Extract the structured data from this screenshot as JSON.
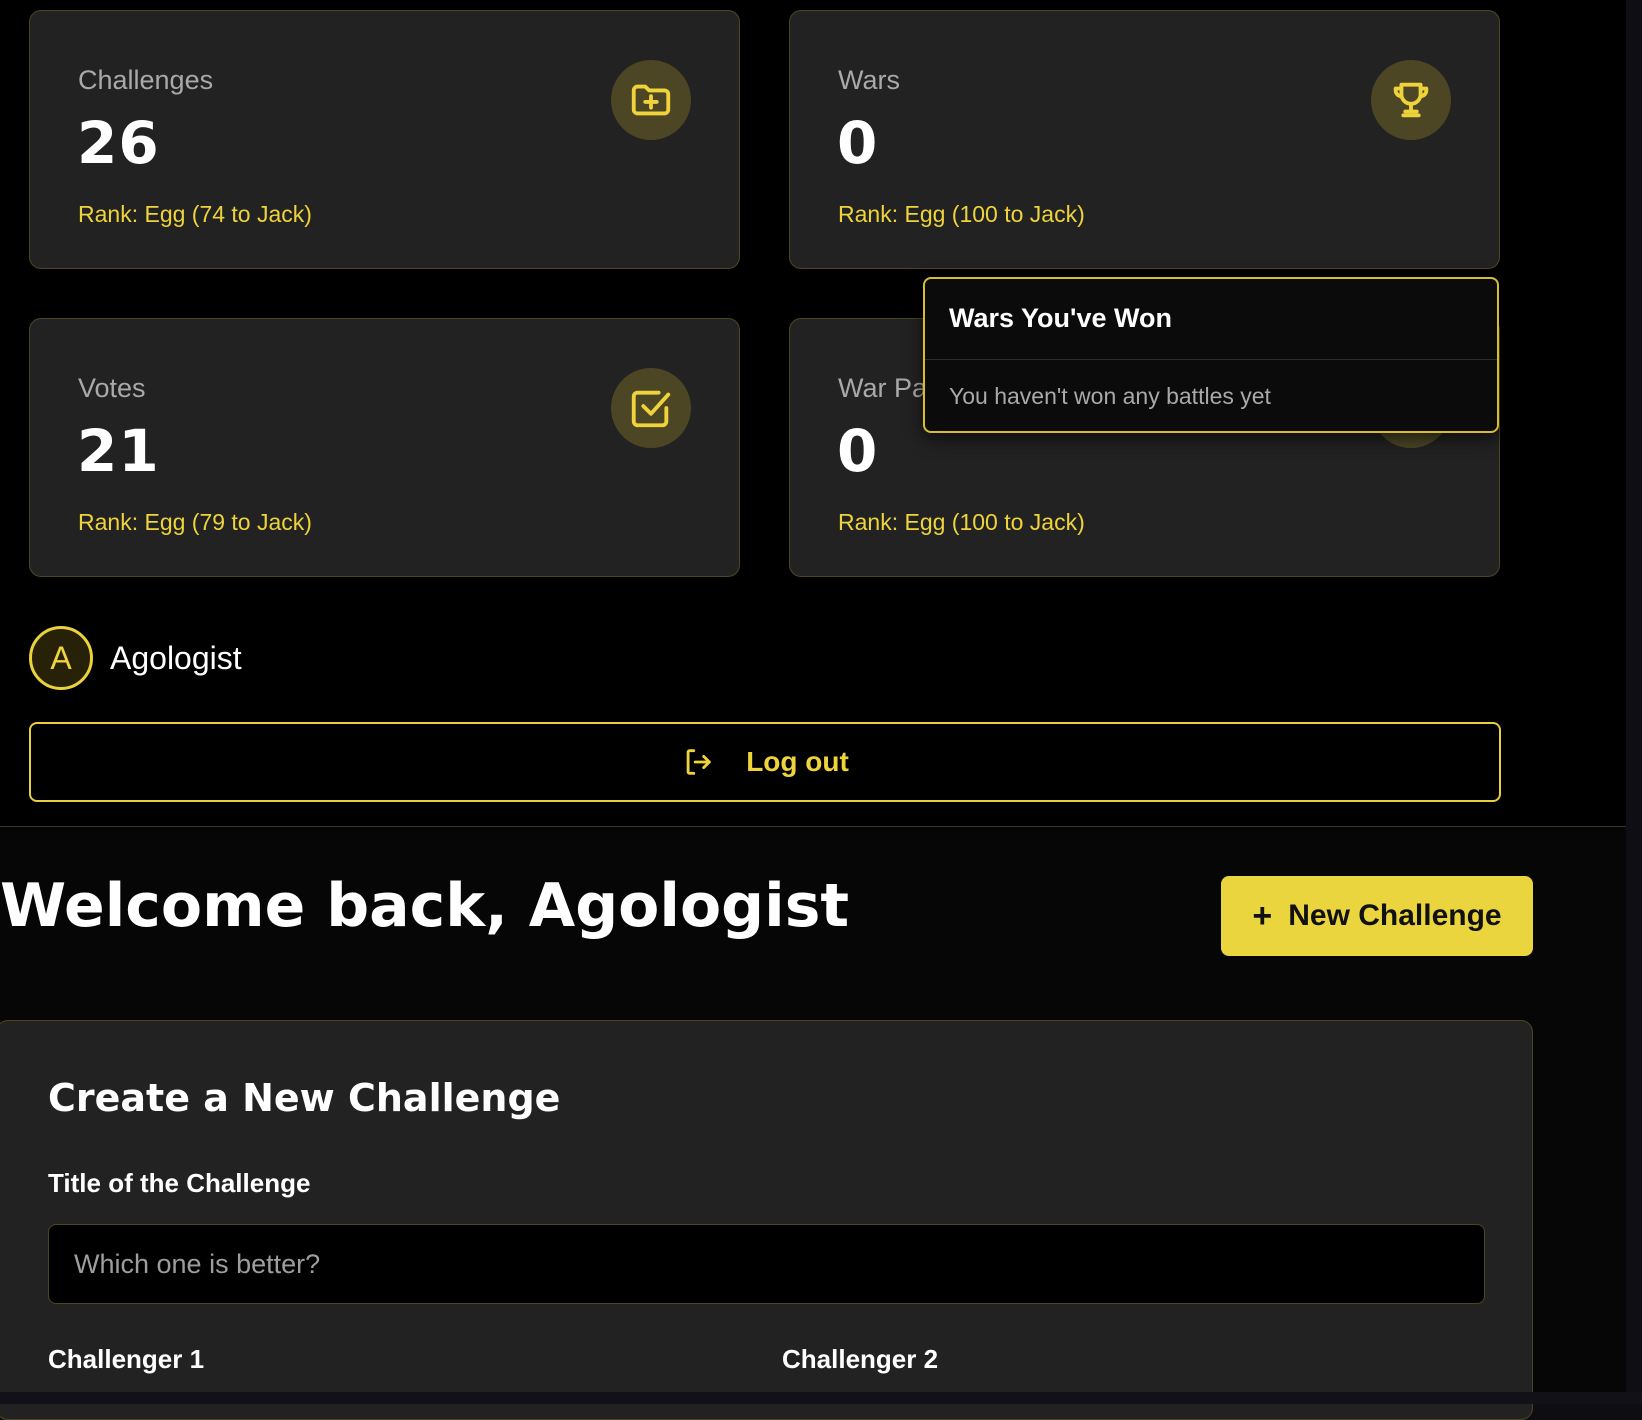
{
  "stats": {
    "challenges": {
      "label": "Challenges",
      "value": "26",
      "rank": "Rank: Egg (74 to Jack)",
      "icon": "folder-plus-icon"
    },
    "wars": {
      "label": "Wars",
      "value": "0",
      "rank": "Rank: Egg (100 to Jack)",
      "icon": "trophy-icon"
    },
    "votes": {
      "label": "Votes",
      "value": "21",
      "rank": "Rank: Egg (79 to Jack)",
      "icon": "checkbox-icon"
    },
    "war_participation": {
      "label": "War Pa",
      "value": "0",
      "rank": "Rank: Egg (100 to Jack)"
    }
  },
  "popover": {
    "title": "Wars You've Won",
    "body": "You haven't won any battles yet"
  },
  "user": {
    "initial": "A",
    "name": "Agologist"
  },
  "logout": {
    "label": "Log out",
    "icon": "logout-icon"
  },
  "main": {
    "welcome": "Welcome back, Agologist",
    "new_button": {
      "plus": "+",
      "label": "New Challenge"
    },
    "create_form": {
      "title": "Create a New Challenge",
      "title_label": "Title of the Challenge",
      "title_placeholder": "Which one is better?",
      "challenger1_label": "Challenger 1",
      "challenger2_label": "Challenger 2"
    }
  },
  "colors": {
    "accent": "#EAD53F",
    "card_bg": "#222222",
    "card_border": "#4E4620"
  }
}
